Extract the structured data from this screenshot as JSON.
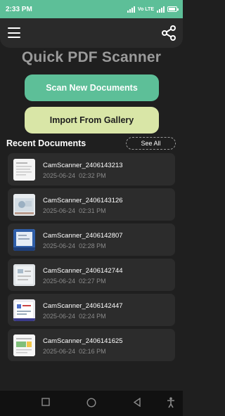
{
  "status_bar": {
    "time": "2:33 PM",
    "network_label": "Vo LTE",
    "icons": [
      "signal-icon",
      "volte-icon",
      "signal-icon",
      "battery-icon"
    ]
  },
  "header": {
    "menu_icon": "hamburger-menu-icon",
    "share_icon": "share-icon"
  },
  "app": {
    "title": "Quick PDF Scanner"
  },
  "actions": {
    "scan_label": "Scan New Documents",
    "import_label": "Import From Gallery"
  },
  "recent": {
    "heading": "Recent Documents",
    "see_all_label": "See All",
    "documents": [
      {
        "name": "CamScanner_2406143213",
        "date": "2025-06-24",
        "time": "02:32 PM"
      },
      {
        "name": "CamScanner_2406143126",
        "date": "2025-06-24",
        "time": "02:31 PM"
      },
      {
        "name": "CamScanner_2406142807",
        "date": "2025-06-24",
        "time": "02:28 PM"
      },
      {
        "name": "CamScanner_2406142744",
        "date": "2025-06-24",
        "time": "02:27 PM"
      },
      {
        "name": "CamScanner_2406142447",
        "date": "2025-06-24",
        "time": "02:24 PM"
      },
      {
        "name": "CamScanner_2406141625",
        "date": "2025-06-24",
        "time": "02:16 PM"
      }
    ]
  },
  "nav_bar": {
    "buttons": [
      "recents-square-icon",
      "home-circle-icon",
      "back-triangle-icon",
      "accessibility-icon"
    ]
  },
  "colors": {
    "accent": "#5dbf98",
    "secondary": "#d9e6a7",
    "background": "#1f1f1f",
    "card": "#2c2c2c"
  }
}
